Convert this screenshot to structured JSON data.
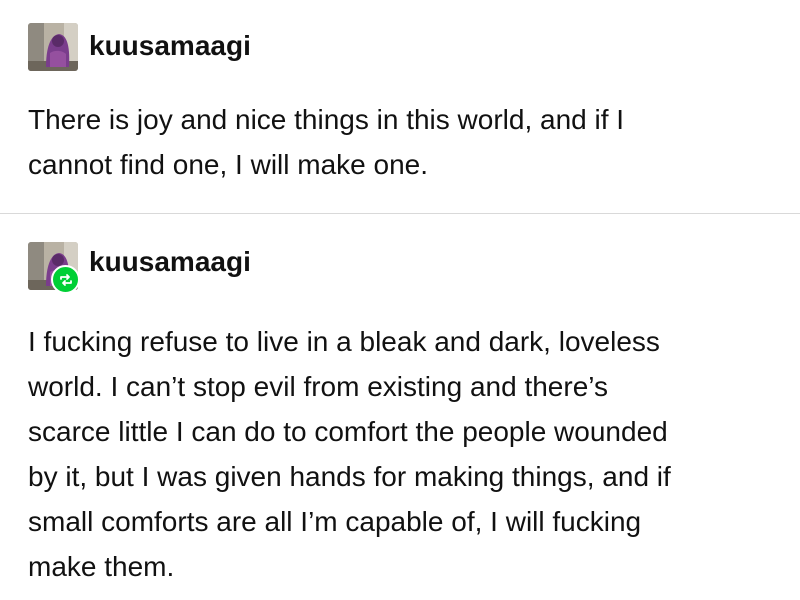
{
  "posts": [
    {
      "username": "kuusamaagi",
      "avatar_icon": "user-avatar",
      "reblogged": false,
      "text": "There is joy and nice things in this world, and if I\ncannot find one, I will make one."
    },
    {
      "username": "kuusamaagi",
      "avatar_icon": "user-avatar",
      "reblogged": true,
      "reblog_icon": "reblog-icon",
      "reblog_color": "#00cf35",
      "text": "I fucking refuse to live in a bleak and dark, loveless\nworld. I can’t stop evil from existing and there’s\nscarce little I can do to comfort the people wounded\nby it, but I was given hands for making things, and if\nsmall comforts are all I’m capable of, I will fucking\nmake them."
    }
  ]
}
